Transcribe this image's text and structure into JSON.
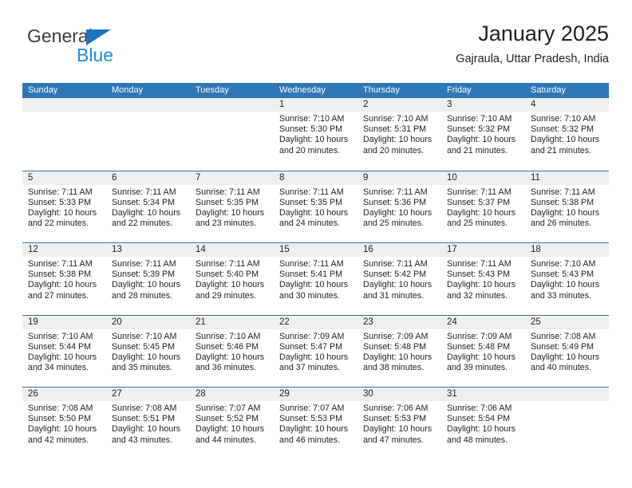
{
  "brand": {
    "name_part1": "General",
    "name_part2": "Blue",
    "triangle_color": "#1e73be",
    "blue_color": "#1e8fe0"
  },
  "header": {
    "title": "January 2025",
    "subtitle": "Gajraula, Uttar Pradesh, India",
    "accent_color": "#2f76b6"
  },
  "calendar": {
    "weekdays": [
      "Sunday",
      "Monday",
      "Tuesday",
      "Wednesday",
      "Thursday",
      "Friday",
      "Saturday"
    ],
    "header_bg": "#2f76b6",
    "header_text_color": "#ffffff",
    "daynum_band_bg": "#efefef",
    "weeks": [
      [
        {
          "day": "",
          "empty": true
        },
        {
          "day": "",
          "empty": true
        },
        {
          "day": "",
          "empty": true
        },
        {
          "day": "1",
          "sunrise": "Sunrise: 7:10 AM",
          "sunset": "Sunset: 5:30 PM",
          "daylight": "Daylight: 10 hours and 20 minutes."
        },
        {
          "day": "2",
          "sunrise": "Sunrise: 7:10 AM",
          "sunset": "Sunset: 5:31 PM",
          "daylight": "Daylight: 10 hours and 20 minutes."
        },
        {
          "day": "3",
          "sunrise": "Sunrise: 7:10 AM",
          "sunset": "Sunset: 5:32 PM",
          "daylight": "Daylight: 10 hours and 21 minutes."
        },
        {
          "day": "4",
          "sunrise": "Sunrise: 7:10 AM",
          "sunset": "Sunset: 5:32 PM",
          "daylight": "Daylight: 10 hours and 21 minutes."
        }
      ],
      [
        {
          "day": "5",
          "sunrise": "Sunrise: 7:11 AM",
          "sunset": "Sunset: 5:33 PM",
          "daylight": "Daylight: 10 hours and 22 minutes."
        },
        {
          "day": "6",
          "sunrise": "Sunrise: 7:11 AM",
          "sunset": "Sunset: 5:34 PM",
          "daylight": "Daylight: 10 hours and 22 minutes."
        },
        {
          "day": "7",
          "sunrise": "Sunrise: 7:11 AM",
          "sunset": "Sunset: 5:35 PM",
          "daylight": "Daylight: 10 hours and 23 minutes."
        },
        {
          "day": "8",
          "sunrise": "Sunrise: 7:11 AM",
          "sunset": "Sunset: 5:35 PM",
          "daylight": "Daylight: 10 hours and 24 minutes."
        },
        {
          "day": "9",
          "sunrise": "Sunrise: 7:11 AM",
          "sunset": "Sunset: 5:36 PM",
          "daylight": "Daylight: 10 hours and 25 minutes."
        },
        {
          "day": "10",
          "sunrise": "Sunrise: 7:11 AM",
          "sunset": "Sunset: 5:37 PM",
          "daylight": "Daylight: 10 hours and 25 minutes."
        },
        {
          "day": "11",
          "sunrise": "Sunrise: 7:11 AM",
          "sunset": "Sunset: 5:38 PM",
          "daylight": "Daylight: 10 hours and 26 minutes."
        }
      ],
      [
        {
          "day": "12",
          "sunrise": "Sunrise: 7:11 AM",
          "sunset": "Sunset: 5:38 PM",
          "daylight": "Daylight: 10 hours and 27 minutes."
        },
        {
          "day": "13",
          "sunrise": "Sunrise: 7:11 AM",
          "sunset": "Sunset: 5:39 PM",
          "daylight": "Daylight: 10 hours and 28 minutes."
        },
        {
          "day": "14",
          "sunrise": "Sunrise: 7:11 AM",
          "sunset": "Sunset: 5:40 PM",
          "daylight": "Daylight: 10 hours and 29 minutes."
        },
        {
          "day": "15",
          "sunrise": "Sunrise: 7:11 AM",
          "sunset": "Sunset: 5:41 PM",
          "daylight": "Daylight: 10 hours and 30 minutes."
        },
        {
          "day": "16",
          "sunrise": "Sunrise: 7:11 AM",
          "sunset": "Sunset: 5:42 PM",
          "daylight": "Daylight: 10 hours and 31 minutes."
        },
        {
          "day": "17",
          "sunrise": "Sunrise: 7:11 AM",
          "sunset": "Sunset: 5:43 PM",
          "daylight": "Daylight: 10 hours and 32 minutes."
        },
        {
          "day": "18",
          "sunrise": "Sunrise: 7:10 AM",
          "sunset": "Sunset: 5:43 PM",
          "daylight": "Daylight: 10 hours and 33 minutes."
        }
      ],
      [
        {
          "day": "19",
          "sunrise": "Sunrise: 7:10 AM",
          "sunset": "Sunset: 5:44 PM",
          "daylight": "Daylight: 10 hours and 34 minutes."
        },
        {
          "day": "20",
          "sunrise": "Sunrise: 7:10 AM",
          "sunset": "Sunset: 5:45 PM",
          "daylight": "Daylight: 10 hours and 35 minutes."
        },
        {
          "day": "21",
          "sunrise": "Sunrise: 7:10 AM",
          "sunset": "Sunset: 5:46 PM",
          "daylight": "Daylight: 10 hours and 36 minutes."
        },
        {
          "day": "22",
          "sunrise": "Sunrise: 7:09 AM",
          "sunset": "Sunset: 5:47 PM",
          "daylight": "Daylight: 10 hours and 37 minutes."
        },
        {
          "day": "23",
          "sunrise": "Sunrise: 7:09 AM",
          "sunset": "Sunset: 5:48 PM",
          "daylight": "Daylight: 10 hours and 38 minutes."
        },
        {
          "day": "24",
          "sunrise": "Sunrise: 7:09 AM",
          "sunset": "Sunset: 5:48 PM",
          "daylight": "Daylight: 10 hours and 39 minutes."
        },
        {
          "day": "25",
          "sunrise": "Sunrise: 7:08 AM",
          "sunset": "Sunset: 5:49 PM",
          "daylight": "Daylight: 10 hours and 40 minutes."
        }
      ],
      [
        {
          "day": "26",
          "sunrise": "Sunrise: 7:08 AM",
          "sunset": "Sunset: 5:50 PM",
          "daylight": "Daylight: 10 hours and 42 minutes."
        },
        {
          "day": "27",
          "sunrise": "Sunrise: 7:08 AM",
          "sunset": "Sunset: 5:51 PM",
          "daylight": "Daylight: 10 hours and 43 minutes."
        },
        {
          "day": "28",
          "sunrise": "Sunrise: 7:07 AM",
          "sunset": "Sunset: 5:52 PM",
          "daylight": "Daylight: 10 hours and 44 minutes."
        },
        {
          "day": "29",
          "sunrise": "Sunrise: 7:07 AM",
          "sunset": "Sunset: 5:53 PM",
          "daylight": "Daylight: 10 hours and 46 minutes."
        },
        {
          "day": "30",
          "sunrise": "Sunrise: 7:06 AM",
          "sunset": "Sunset: 5:53 PM",
          "daylight": "Daylight: 10 hours and 47 minutes."
        },
        {
          "day": "31",
          "sunrise": "Sunrise: 7:06 AM",
          "sunset": "Sunset: 5:54 PM",
          "daylight": "Daylight: 10 hours and 48 minutes."
        },
        {
          "day": "",
          "empty": true
        }
      ]
    ]
  }
}
